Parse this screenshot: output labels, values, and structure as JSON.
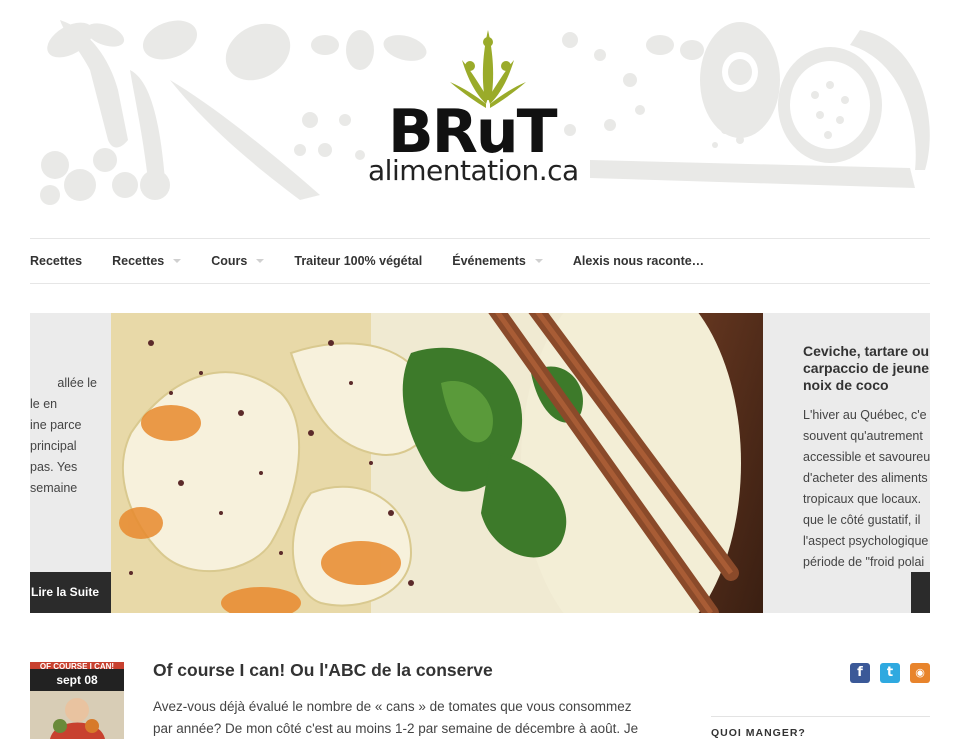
{
  "logo": {
    "word": "BRuT",
    "subtitle": "alimentation.ca",
    "colors": {
      "green": "#9aab2a",
      "dark": "#111111"
    }
  },
  "nav": {
    "items": [
      {
        "label": "Recettes"
      },
      {
        "label": "Recettes"
      },
      {
        "label": "Cours"
      },
      {
        "label": "Traiteur 100% végétal"
      },
      {
        "label": "Événements"
      },
      {
        "label": "Alexis nous raconte…"
      }
    ]
  },
  "slider": {
    "left_text": [
      "allée le",
      "le en",
      "ine parce",
      "principal",
      "pas. Yes",
      "semaine"
    ],
    "read_more": "Lire la Suite",
    "right_title": [
      "Ceviche, tartare ou",
      "carpaccio de jeune",
      "noix de coco"
    ],
    "right_text": [
      "L'hiver au Québec, c'e",
      "souvent qu'autrement",
      "accessible et savoureu",
      "d'acheter des aliments",
      "tropicaux que locaux.",
      "que le côté gustatif, il",
      "l'aspect psychologique",
      "période de \"froid polai"
    ]
  },
  "post": {
    "thumb_caption": "OF COURSE I CAN!",
    "date": "sept 08",
    "title": "Of course I can! Ou l'ABC de la conserve",
    "excerpt_lines": [
      "Avez-vous déjà évalué le nombre de « cans » de tomates que vous consommez",
      "par année? De mon côté c'est au moins 1-2 par semaine de décembre à août. Je"
    ]
  },
  "social": [
    {
      "icon": "facebook-icon",
      "glyph": "f",
      "color": "#3b5998"
    },
    {
      "icon": "twitter-icon",
      "glyph": "t",
      "color": "#2fa9e0"
    },
    {
      "icon": "rss-icon",
      "glyph": "◉",
      "color": "#e8842c"
    }
  ],
  "sidebar": {
    "heading": "QUOI MANGER?"
  }
}
